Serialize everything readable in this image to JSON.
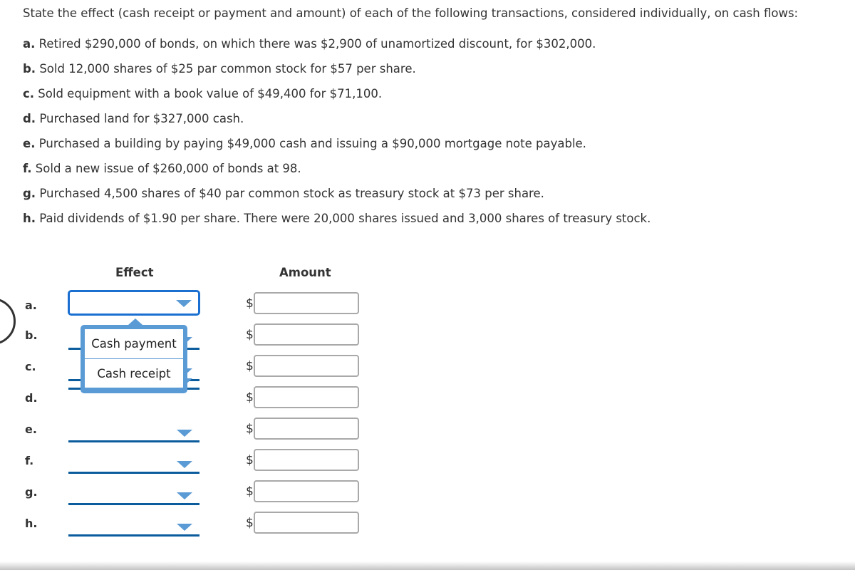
{
  "prompt": "State the effect (cash receipt or payment and amount) of each of the following transactions, considered individually, on cash flows:",
  "transactions": [
    {
      "letter": "a.",
      "text": " Retired $290,000 of bonds, on which there was $2,900 of unamortized discount, for $302,000."
    },
    {
      "letter": "b.",
      "text": " Sold 12,000 shares of $25 par common stock for $57 per share."
    },
    {
      "letter": "c.",
      "text": " Sold equipment with a book value of $49,400 for $71,100."
    },
    {
      "letter": "d.",
      "text": " Purchased land for $327,000 cash."
    },
    {
      "letter": "e.",
      "text": " Purchased a building by paying $49,000 cash and issuing a $90,000 mortgage note payable."
    },
    {
      "letter": "f.",
      "text": " Sold a new issue of $260,000 of bonds at 98."
    },
    {
      "letter": "g.",
      "text": " Purchased 4,500 shares of $40 par common stock as treasury stock at $73 per share."
    },
    {
      "letter": "h.",
      "text": " Paid dividends of $1.90 per share. There were 20,000 shares issued and 3,000 shares of treasury stock."
    }
  ],
  "table": {
    "effect_header": "Effect",
    "amount_header": "Amount",
    "currency_symbol": "$",
    "rows": [
      {
        "label": "a.",
        "effect": "",
        "amount": ""
      },
      {
        "label": "b.",
        "effect": "",
        "amount": ""
      },
      {
        "label": "c.",
        "effect": "",
        "amount": ""
      },
      {
        "label": "d.",
        "effect": "",
        "amount": ""
      },
      {
        "label": "e.",
        "effect": "",
        "amount": ""
      },
      {
        "label": "f.",
        "effect": "",
        "amount": ""
      },
      {
        "label": "g.",
        "effect": "",
        "amount": ""
      },
      {
        "label": "h.",
        "effect": "",
        "amount": ""
      }
    ]
  },
  "dropdown": {
    "open_for_row": "a.",
    "options": [
      "Cash payment",
      "Cash receipt"
    ]
  },
  "colors": {
    "accent": "#1a6fd1",
    "select_underline": "#0b5c9c",
    "arrow": "#5b9bd5"
  }
}
